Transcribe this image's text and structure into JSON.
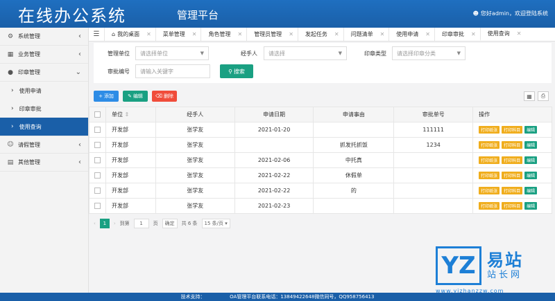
{
  "header": {
    "logo": "在线办公系统",
    "subtitle": "管理平台",
    "user_text": "您好admin，欢迎登陆系统"
  },
  "sidebar": {
    "items": [
      {
        "label": "系统管理",
        "icon": "gear-icon"
      },
      {
        "label": "业务管理",
        "icon": "grid-icon"
      },
      {
        "label": "印章管理",
        "icon": "dot-icon"
      },
      {
        "label": "请假管理",
        "icon": "user-icon"
      },
      {
        "label": "其他管理",
        "icon": "doc-icon"
      }
    ],
    "sub_items": [
      {
        "label": "使用申请"
      },
      {
        "label": "印章审批"
      },
      {
        "label": "使用查询"
      }
    ]
  },
  "tabs": [
    {
      "label": "我的桌面"
    },
    {
      "label": "菜单管理"
    },
    {
      "label": "角色管理"
    },
    {
      "label": "管理员管理"
    },
    {
      "label": "发起任务"
    },
    {
      "label": "问题清单"
    },
    {
      "label": "使用申请"
    },
    {
      "label": "印章审批"
    },
    {
      "label": "使用查询"
    }
  ],
  "filters": {
    "dept_label": "管理单位",
    "dept_placeholder": "请选择单位",
    "handler_label": "经手人",
    "handler_placeholder": "请选择",
    "type_label": "印章类型",
    "type_placeholder": "请选择印章分类",
    "approval_label": "审批编号",
    "approval_placeholder": "请输入关键字",
    "search_label": "搜索"
  },
  "toolbar": {
    "add": "添加",
    "edit": "编辑",
    "delete": "删除"
  },
  "table": {
    "headers": [
      "单位",
      "经手人",
      "申请日期",
      "申请事由",
      "审批单号",
      "操作"
    ],
    "ops": [
      "打印纸张",
      "打印科目",
      "编辑"
    ],
    "rows": [
      [
        "开发部",
        "张学友",
        "2021-01-20",
        "",
        "111111"
      ],
      [
        "开发部",
        "张学友",
        "",
        "抓发托抓饭",
        "1234"
      ],
      [
        "开发部",
        "张学友",
        "2021-02-06",
        "中托真",
        ""
      ],
      [
        "开发部",
        "张学友",
        "2021-02-22",
        "休假单",
        ""
      ],
      [
        "开发部",
        "张学友",
        "2021-02-22",
        "的",
        ""
      ],
      [
        "开发部",
        "张学友",
        "2021-02-23",
        "",
        ""
      ]
    ]
  },
  "pager": {
    "current": "1",
    "goto_label": "到第",
    "goto_value": "1",
    "page_unit": "页",
    "confirm": "确定",
    "total": "共 6 条",
    "per_page": "15 条/页"
  },
  "watermark": {
    "mark": "YZ",
    "name": "易站",
    "tag": "站长网",
    "url": "www.yizhanzzw.com"
  },
  "footer": {
    "text": "技术支持：                OA管理平台联系电话：13849422648微信同号，QQ958756413"
  }
}
